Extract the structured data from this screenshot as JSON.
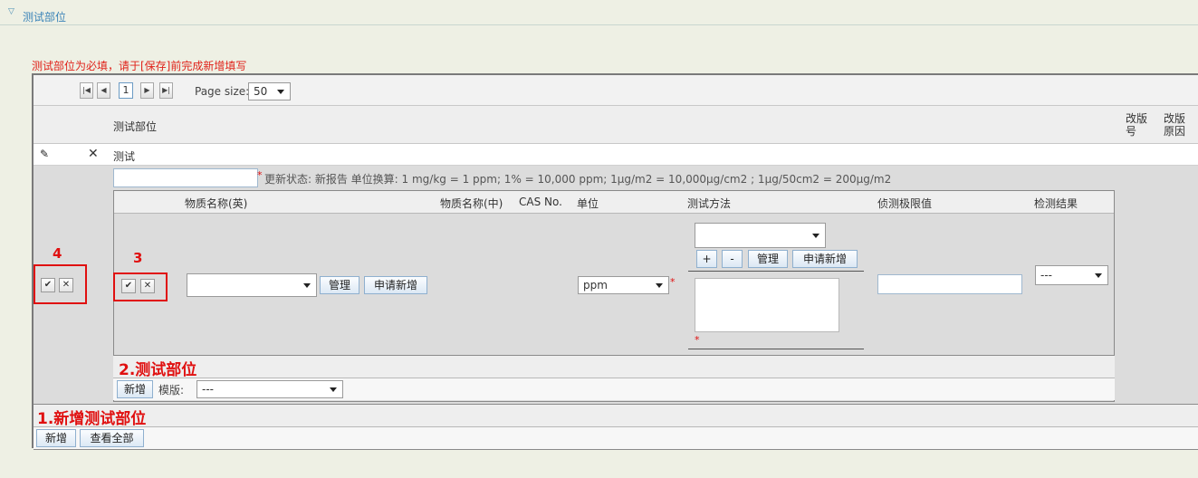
{
  "section": {
    "title": "测试部位",
    "arrow_icon": "chevron-down-icon"
  },
  "warning": "测试部位为必填，请于[保存]前完成新增填写",
  "pager": {
    "page": "1",
    "page_size_label": "Page size:",
    "page_size": "50"
  },
  "grid_header": {
    "col_part": "测试部位",
    "col_rev_no_1": "改版",
    "col_rev_no_2": "号",
    "col_rev_reason_1": "改版",
    "col_rev_reason_2": "原因"
  },
  "row": {
    "part_name": "测试"
  },
  "info_line": "更新状态:  新报告 单位换算: 1 mg/kg = 1 ppm;  1% = 10,000 ppm;  1μg/m2 = 10,000μg/cm2 ;   1μg/50cm2 = 200μg/m2",
  "inner_header": {
    "name_en": "物质名称(英)",
    "name_cn": "物质名称(中)",
    "cas": "CAS No.",
    "unit": "单位",
    "method": "测试方法",
    "limit": "侦测极限值",
    "result": "检测结果"
  },
  "inner_row": {
    "manage": "管理",
    "apply_new": "申请新增",
    "unit_value": "ppm",
    "method_plus": "+",
    "method_minus": "-",
    "method_manage": "管理",
    "method_apply": "申请新增",
    "result_value": "---"
  },
  "annotations": {
    "n3": "3",
    "n4": "4",
    "label2": "2.测试部位",
    "label1": "1.新增测试部位"
  },
  "inner_footer": {
    "add": "新增",
    "template_label": "模版:",
    "template_value": "---"
  },
  "footer": {
    "add": "新增",
    "view_all": "查看全部"
  }
}
